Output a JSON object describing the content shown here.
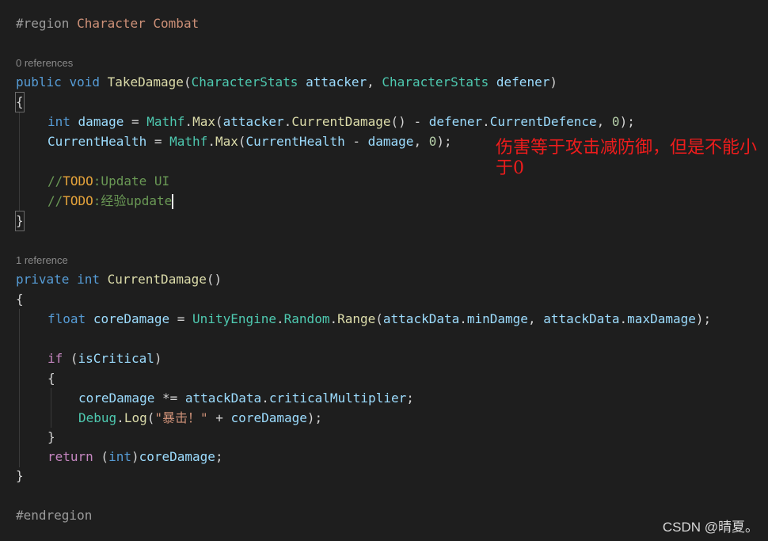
{
  "code": {
    "region": {
      "directive": "#region",
      "name": "Character Combat"
    },
    "lens1": "0 references",
    "take_damage": {
      "public": "public",
      "void": "void",
      "name": "TakeDamage",
      "open_paren": "(",
      "type1": "CharacterStats",
      "param1": "attacker",
      "comma": ", ",
      "type2": "CharacterStats",
      "param2": "defener",
      "close_paren": ")"
    },
    "open_brace_1": "{",
    "line_damage": {
      "int": "int",
      "var": "damage",
      "eq": " = ",
      "mathf": "Mathf",
      "dot": ".",
      "max": "Max",
      "p1": "(",
      "attacker": "attacker",
      "dot2": ".",
      "current_damage": "CurrentDamage",
      "call": "() - ",
      "defener": "defener",
      "dot3": ".",
      "current_defence": "CurrentDefence",
      "sep": ", ",
      "zero": "0",
      "end": ");"
    },
    "line_health": {
      "current_health": "CurrentHealth",
      "eq": " = ",
      "mathf": "Mathf",
      "dot": ".",
      "max": "Max",
      "p1": "(",
      "current_health2": "CurrentHealth",
      "minus": " - ",
      "damage": "damage",
      "sep": ", ",
      "zero": "0",
      "end": ");"
    },
    "todo1": {
      "slashes": "//",
      "tag": "TODO",
      "text": ":Update UI"
    },
    "todo2": {
      "slashes": "//",
      "tag": "TODO",
      "text": ":经验update"
    },
    "close_brace_1": "}",
    "lens2": "1 reference",
    "current_damage": {
      "private": "private",
      "int": "int",
      "name": "CurrentDamage",
      "parens": "()"
    },
    "open_brace_2": "{",
    "line_core": {
      "float": "float",
      "var": "coreDamage",
      "eq": " = ",
      "unity": "UnityEngine",
      "dot": ".",
      "random": "Random",
      "dot2": ".",
      "range": "Range",
      "p1": "(",
      "attack_data": "attackData",
      "dot3": ".",
      "min": "minDamge",
      "sep": ", ",
      "attack_data2": "attackData",
      "dot4": ".",
      "max": "maxDamage",
      "end": ");"
    },
    "if_line": {
      "if": "if",
      "open": " (",
      "cond": "isCritical",
      "close": ")"
    },
    "open_brace_3": "{",
    "line_mult": {
      "var": "coreDamage",
      "op": " *= ",
      "attack_data": "attackData",
      "dot": ".",
      "mult": "criticalMultiplier",
      "end": ";"
    },
    "line_log": {
      "debug": "Debug",
      "dot": ".",
      "log": "Log",
      "p1": "(",
      "str": "\"暴击！\"",
      "plus": " + ",
      "var": "coreDamage",
      "end": ");"
    },
    "close_brace_3": "}",
    "return_line": {
      "return": "return",
      "open": " (",
      "int": "int",
      "close": ")",
      "var": "coreDamage",
      "end": ";"
    },
    "close_brace_2": "}",
    "endregion": "#endregion"
  },
  "annotation": "伤害等于攻击减防御，但是不能小于0",
  "watermark": "CSDN @晴夏。",
  "colors": {
    "background": "#1e1e1e",
    "keyword": "#569cd6",
    "type": "#4ec9b0",
    "function": "#dcdcaa",
    "variable": "#9cdcfe",
    "comment": "#6a9955",
    "todo": "#e5a33b",
    "annotation": "#ee1c1c"
  }
}
